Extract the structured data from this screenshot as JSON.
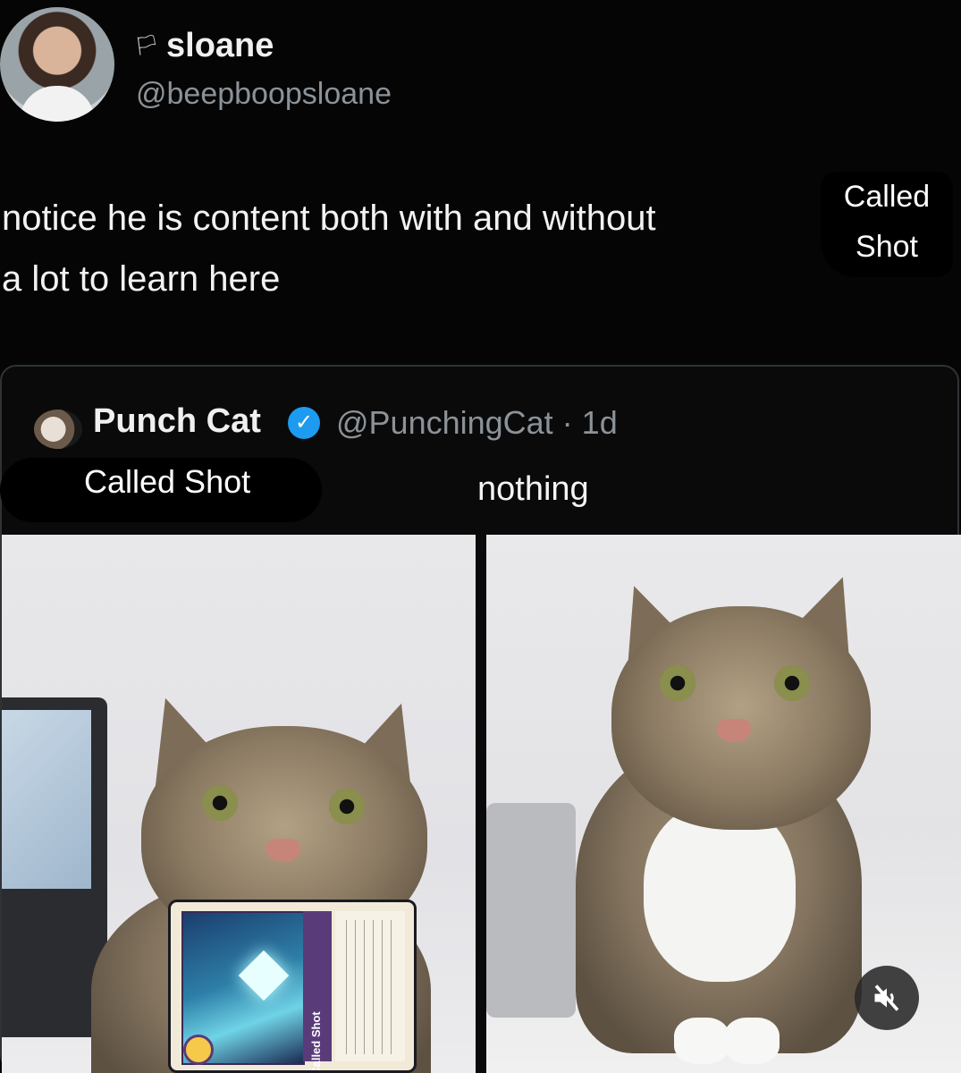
{
  "tweet": {
    "author_emoji": "🏳",
    "display_name": "sloane",
    "handle": "@beepboopsloane",
    "line1": "notice he is content both with and without",
    "line2": "a lot to learn here",
    "overlay_label": "Called\nShot"
  },
  "quoted": {
    "display_name": "Punch Cat",
    "handle_and_time": "@PunchingCat · 1d",
    "verified_mark": "✓",
    "label_left": "Called Shot",
    "label_right": "nothing"
  },
  "card": {
    "title": "Called Shot"
  },
  "icons": {
    "mute": "speaker-muted-icon",
    "verified": "verified-badge-icon"
  },
  "colors": {
    "background": "#050505",
    "verified": "#1d9bf0",
    "card_purple": "#5a3b7a"
  }
}
